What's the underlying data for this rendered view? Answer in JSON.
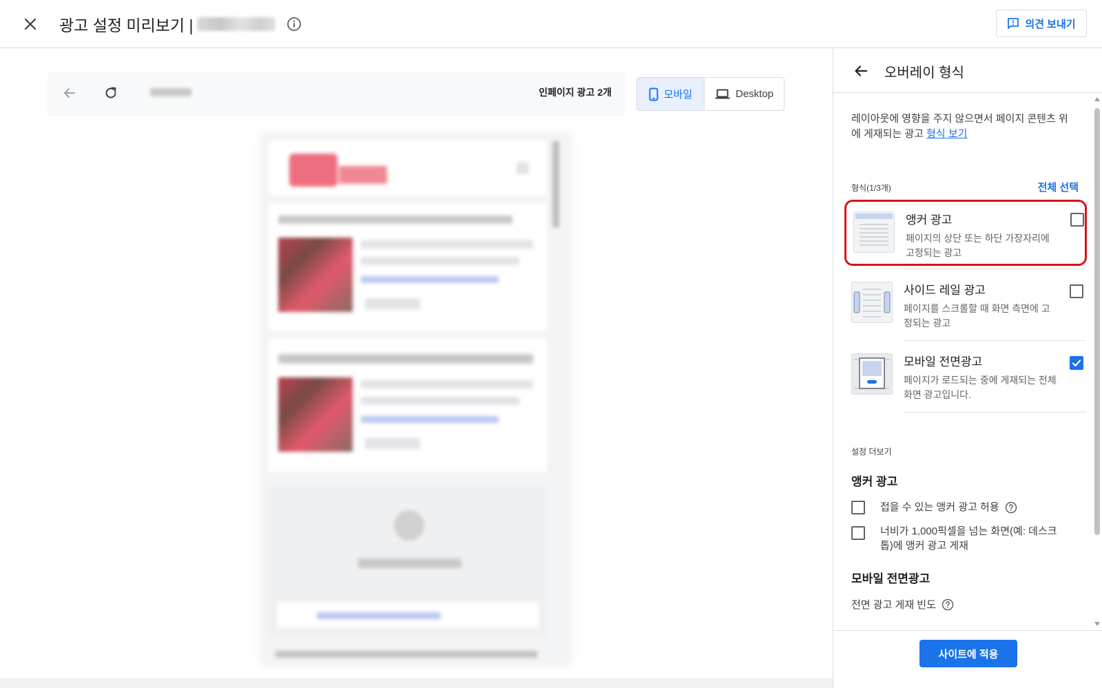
{
  "header": {
    "title": "광고 설정 미리보기 |",
    "feedback_label": "의견 보내기"
  },
  "preview": {
    "ad_count": "인페이지 광고 2개",
    "device_mobile": "모바일",
    "device_desktop": "Desktop"
  },
  "panel": {
    "title": "오버레이 형식",
    "description": "레이아웃에 영향을 주지 않으면서 페이지 콘텐츠 위에 게재되는 광고",
    "description_link": "형식 보기",
    "format_count": "형식(1/3개)",
    "select_all": "전체 선택",
    "formats": [
      {
        "name": "앵커 광고",
        "desc": "페이지의 상단 또는 하단 가장자리에 고정되는 광고",
        "checked": false
      },
      {
        "name": "사이드 레일 광고",
        "desc": "페이지를 스크롤할 때 화면 측면에 고정되는 광고",
        "checked": false
      },
      {
        "name": "모바일 전면광고",
        "desc": "페이지가 로드되는 중에 게재되는 전체 화면 광고입니다.",
        "checked": true
      }
    ],
    "more_settings": "설정 더보기",
    "anchor_section": "앵커 광고",
    "anchor_options": [
      "접을 수 있는 앵커 광고 허용",
      "너비가 1,000픽셀을 넘는 화면(예: 데스크톱)에 앵커 광고 게재"
    ],
    "vignette_section": "모바일 전면광고",
    "frequency_label": "전면 광고 게재 빈도",
    "apply_label": "사이트에 적용"
  },
  "colors": {
    "accent": "#1a73e8",
    "highlight": "#d9121a"
  }
}
